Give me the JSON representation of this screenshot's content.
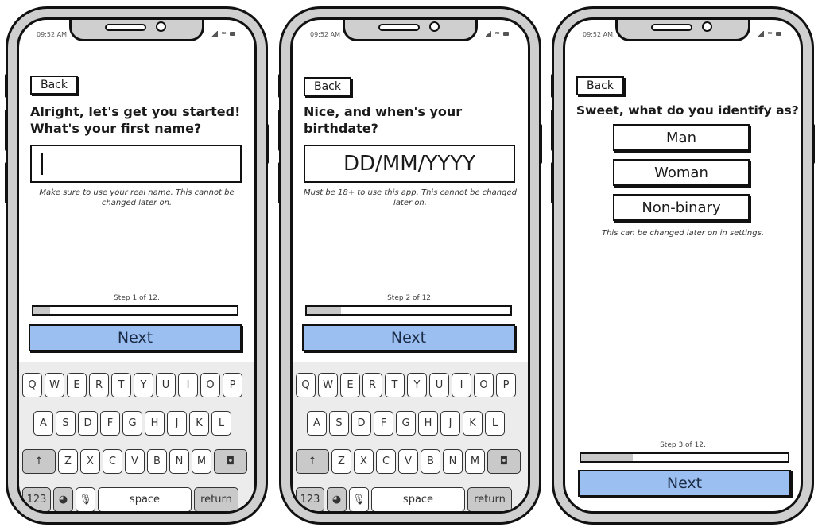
{
  "status_bar": {
    "time": "09:52 AM"
  },
  "screens": [
    {
      "back_label": "Back",
      "question": "Alright, let's get you started! What's your first name?",
      "input": {
        "value": "",
        "placeholder": ""
      },
      "hint": "Make sure to use your real name. This cannot be changed later on.",
      "step_label": "Step 1 of 12.",
      "progress": {
        "current": 1,
        "total": 12
      },
      "next_label": "Next"
    },
    {
      "back_label": "Back",
      "question": "Nice, and when's your birthdate?",
      "input": {
        "value": "",
        "placeholder": "DD/MM/YYYY"
      },
      "hint": "Must be 18+ to use this app. This cannot be changed later on.",
      "step_label": "Step 2 of 12.",
      "progress": {
        "current": 2,
        "total": 12
      },
      "next_label": "Next"
    },
    {
      "back_label": "Back",
      "question": "Sweet, what do you identify as?",
      "options": [
        "Man",
        "Woman",
        "Non-binary"
      ],
      "hint": "This can be changed later on in settings.",
      "step_label": "Step 3 of 12.",
      "progress": {
        "current": 3,
        "total": 12
      },
      "next_label": "Next"
    }
  ],
  "keyboard": {
    "row1": [
      "Q",
      "W",
      "E",
      "R",
      "T",
      "Y",
      "U",
      "I",
      "O",
      "P"
    ],
    "row2": [
      "A",
      "S",
      "D",
      "F",
      "G",
      "H",
      "J",
      "K",
      "L"
    ],
    "row3": [
      "Z",
      "X",
      "C",
      "V",
      "B",
      "N",
      "M"
    ],
    "shift": "↑",
    "backspace": "◘",
    "numbers": "123",
    "globe": "◕",
    "mic": "🎙",
    "space": "space",
    "return": "return"
  },
  "colors": {
    "accent": "#9bbff0",
    "progress_fill": "#c8c8c8",
    "frame": "#cfcfcf"
  }
}
